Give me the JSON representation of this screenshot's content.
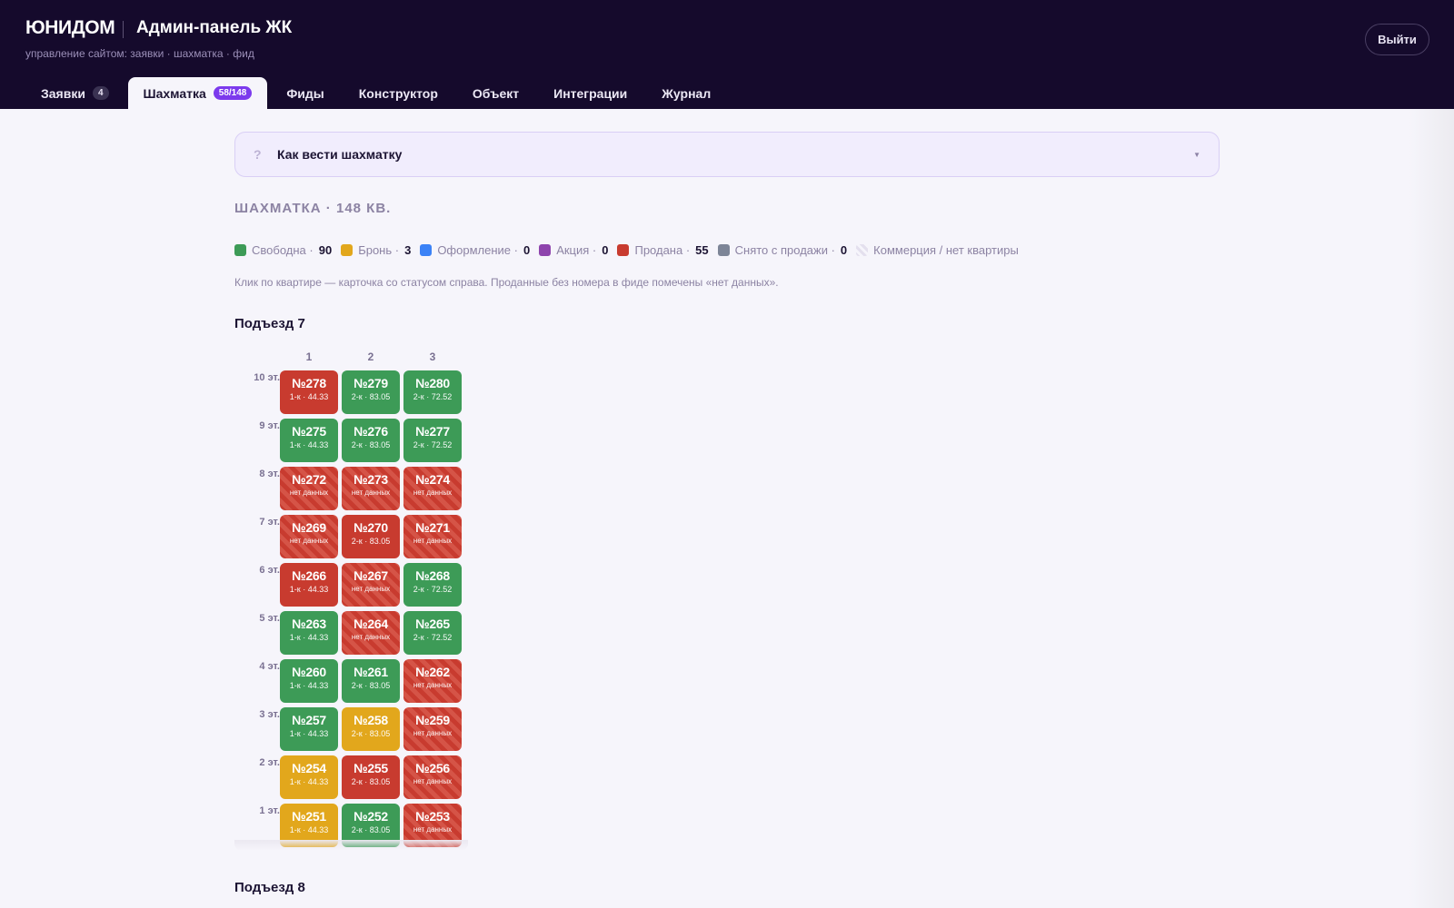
{
  "header": {
    "brand": "ЮНИДОМ",
    "title": "Админ-панель ЖК",
    "subtitle": "управление сайтом: заявки · шахматка · фид",
    "logout_label": "Выйти"
  },
  "tabs": [
    {
      "label": "Заявки",
      "count": "4",
      "active": false
    },
    {
      "label": "Шахматка",
      "count": "58/148",
      "active": true
    },
    {
      "label": "Фиды",
      "count": "",
      "active": false
    },
    {
      "label": "Конструктор",
      "count": "",
      "active": false
    },
    {
      "label": "Объект",
      "count": "",
      "active": false
    },
    {
      "label": "Интеграции",
      "count": "",
      "active": false
    },
    {
      "label": "Журнал",
      "count": "",
      "active": false
    }
  ],
  "help": {
    "icon": "?",
    "title": "Как вести шахматку",
    "caret": "▼"
  },
  "section_title": "ШАХМАТКА · 148 КВ.",
  "legend": [
    {
      "label": "Свободна ·",
      "count": "90",
      "color": "#3d9b57"
    },
    {
      "label": "Бронь ·",
      "count": "3",
      "color": "#e2a71c"
    },
    {
      "label": "Оформление ·",
      "count": "0",
      "color": "#3b82f6"
    },
    {
      "label": "Акция ·",
      "count": "0",
      "color": "#8e44ad"
    },
    {
      "label": "Продана ·",
      "count": "55",
      "color": "#c83b2f"
    },
    {
      "label": "Снято с продажи ·",
      "count": "0",
      "color": "#7d8597"
    },
    {
      "label": "Коммерция / нет квартиры",
      "count": "",
      "color": "hatch"
    }
  ],
  "hint": "Клик по квартире — карточка со статусом справа. Проданные без номера в фиде помечены «нет данных».",
  "entrances": [
    {
      "title": "Подъезд 7",
      "columns": [
        "1",
        "2",
        "3"
      ],
      "floors": [
        {
          "label": "10 эт.",
          "apts": [
            {
              "num": "№278",
              "info": "1-к · 44.33",
              "status": "sold"
            },
            {
              "num": "№279",
              "info": "2-к · 83.05",
              "status": "free"
            },
            {
              "num": "№280",
              "info": "2-к · 72.52",
              "status": "free"
            }
          ]
        },
        {
          "label": "9 эт.",
          "apts": [
            {
              "num": "№275",
              "info": "1-к · 44.33",
              "status": "free"
            },
            {
              "num": "№276",
              "info": "2-к · 83.05",
              "status": "free"
            },
            {
              "num": "№277",
              "info": "2-к · 72.52",
              "status": "free"
            }
          ]
        },
        {
          "label": "8 эт.",
          "apts": [
            {
              "num": "№272",
              "info": "нет данных",
              "status": "sold nodata"
            },
            {
              "num": "№273",
              "info": "нет данных",
              "status": "sold nodata"
            },
            {
              "num": "№274",
              "info": "нет данных",
              "status": "sold nodata"
            }
          ]
        },
        {
          "label": "7 эт.",
          "apts": [
            {
              "num": "№269",
              "info": "нет данных",
              "status": "sold nodata"
            },
            {
              "num": "№270",
              "info": "2-к · 83.05",
              "status": "sold"
            },
            {
              "num": "№271",
              "info": "нет данных",
              "status": "sold nodata"
            }
          ]
        },
        {
          "label": "6 эт.",
          "apts": [
            {
              "num": "№266",
              "info": "1-к · 44.33",
              "status": "sold"
            },
            {
              "num": "№267",
              "info": "нет данных",
              "status": "sold nodata"
            },
            {
              "num": "№268",
              "info": "2-к · 72.52",
              "status": "free"
            }
          ]
        },
        {
          "label": "5 эт.",
          "apts": [
            {
              "num": "№263",
              "info": "1-к · 44.33",
              "status": "free"
            },
            {
              "num": "№264",
              "info": "нет данных",
              "status": "sold nodata"
            },
            {
              "num": "№265",
              "info": "2-к · 72.52",
              "status": "free"
            }
          ]
        },
        {
          "label": "4 эт.",
          "apts": [
            {
              "num": "№260",
              "info": "1-к · 44.33",
              "status": "free"
            },
            {
              "num": "№261",
              "info": "2-к · 83.05",
              "status": "free"
            },
            {
              "num": "№262",
              "info": "нет данных",
              "status": "sold nodata"
            }
          ]
        },
        {
          "label": "3 эт.",
          "apts": [
            {
              "num": "№257",
              "info": "1-к · 44.33",
              "status": "free"
            },
            {
              "num": "№258",
              "info": "2-к · 83.05",
              "status": "booked"
            },
            {
              "num": "№259",
              "info": "нет данных",
              "status": "sold nodata"
            }
          ]
        },
        {
          "label": "2 эт.",
          "apts": [
            {
              "num": "№254",
              "info": "1-к · 44.33",
              "status": "booked"
            },
            {
              "num": "№255",
              "info": "2-к · 83.05",
              "status": "sold"
            },
            {
              "num": "№256",
              "info": "нет данных",
              "status": "sold nodata"
            }
          ]
        },
        {
          "label": "1 эт.",
          "apts": [
            {
              "num": "№251",
              "info": "1-к · 44.33",
              "status": "booked"
            },
            {
              "num": "№252",
              "info": "2-к · 83.05",
              "status": "free"
            },
            {
              "num": "№253",
              "info": "нет данных",
              "status": "sold nodata"
            }
          ]
        }
      ]
    },
    {
      "title": "Подъезд 8",
      "columns": [],
      "floors": []
    }
  ]
}
